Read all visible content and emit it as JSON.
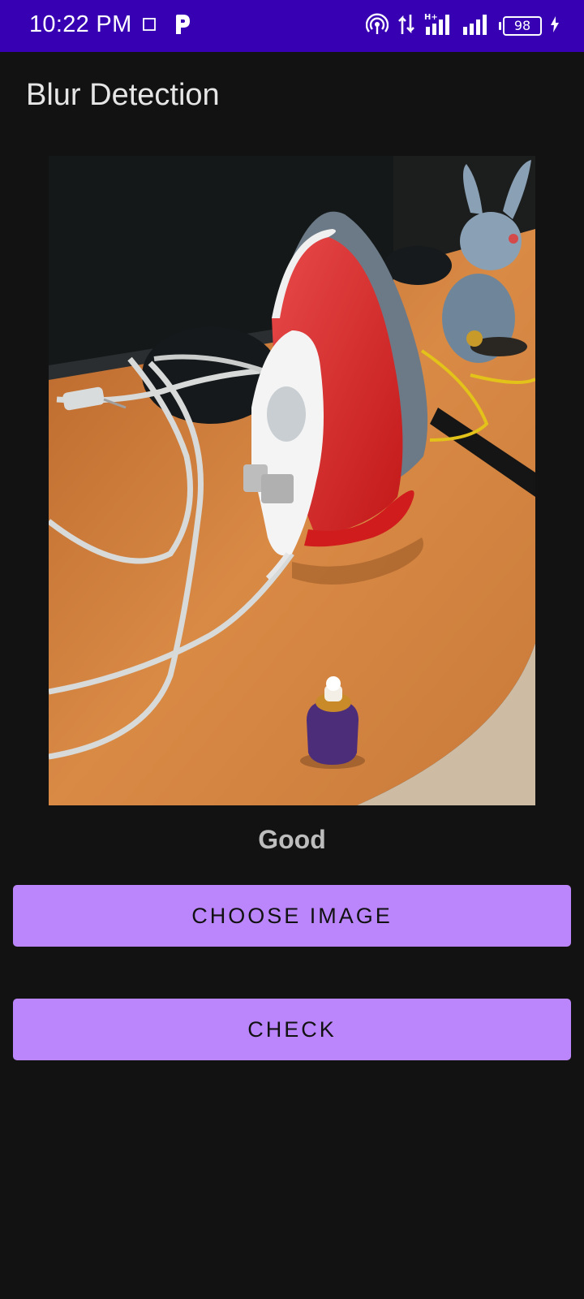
{
  "status_bar": {
    "time": "10:22 PM",
    "battery_level": "98",
    "left_icons": [
      "screenshot-icon",
      "parking-app-icon"
    ],
    "right_icons": [
      "hotspot-icon",
      "data-transfer-icon",
      "signal-hplus-icon",
      "signal-icon",
      "battery-icon",
      "charging-icon"
    ],
    "network_type": "H+"
  },
  "app": {
    "title": "Blur Detection"
  },
  "photo": {
    "description_icon": "selected-photo"
  },
  "result": {
    "label": "Good"
  },
  "buttons": {
    "choose_image": "CHOOSE IMAGE",
    "check": "CHECK"
  },
  "colors": {
    "status_bar": "#3700B3",
    "background": "#121212",
    "button": "#BB86FC",
    "button_text": "#111111",
    "title_text": "#e6e6e6",
    "result_text": "#bdbdbd"
  }
}
